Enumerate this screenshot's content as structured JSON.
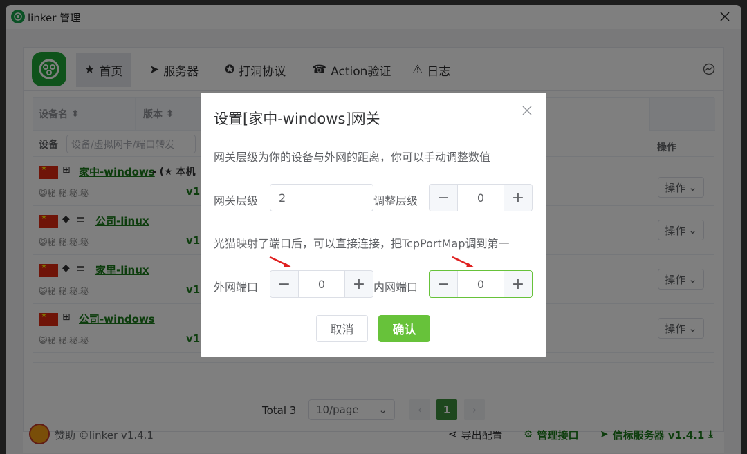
{
  "window": {
    "title": "linker 管理"
  },
  "nav": {
    "items": [
      {
        "label": "首页",
        "icon": "star-icon"
      },
      {
        "label": "服务器",
        "icon": "send-icon"
      },
      {
        "label": "打洞协议",
        "icon": "gear-icon"
      },
      {
        "label": "Action验证",
        "icon": "phone-icon"
      },
      {
        "label": "日志",
        "icon": "warning-icon"
      }
    ]
  },
  "table": {
    "headers": {
      "name": "设备名",
      "version": "版本",
      "ops": "操作"
    },
    "filter": {
      "label": "设备",
      "placeholder": "设备/虚拟网卡/端口转发"
    },
    "rows": [
      {
        "name": "家中-windows",
        "extra": "- (★ 本机",
        "badges": "😺秘.秘.秘.秘",
        "version": "v1.",
        "op": "操作"
      },
      {
        "name": "公司-linux",
        "badges": "😺秘.秘.秘.秘",
        "version": "v1.",
        "op": "操作"
      },
      {
        "name": "家里-linux",
        "badges": "😺秘.秘.秘.秘",
        "version": "v1.",
        "op": "操作"
      },
      {
        "name": "公司-windows",
        "badges": "😺秘.秘.秘.秘",
        "version": "v1.",
        "op": "操作"
      }
    ]
  },
  "pager": {
    "total": "Total 3",
    "pagesize": "10/page",
    "current": "1"
  },
  "footer": {
    "left": "赞助 ©linker v1.4.1",
    "export": "导出配置",
    "api": "管理接口",
    "signal": "信标服务器 v1.4.1"
  },
  "dialog": {
    "title": "设置[家中-windows]网关",
    "desc1": "网关层级为你的设备与外网的距离，你可以手动调整数值",
    "gateway_label": "网关层级",
    "gateway_value": "2",
    "adjust_label": "调整层级",
    "adjust_value": "0",
    "desc2": "光猫映射了端口后，可以直接连接，把TcpPortMap调到第一",
    "wan_label": "外网端口",
    "wan_value": "0",
    "lan_label": "内网端口",
    "lan_value": "0",
    "cancel": "取消",
    "confirm": "确认"
  },
  "colors": {
    "accent": "#67c23a",
    "link": "#1a7a1a"
  }
}
